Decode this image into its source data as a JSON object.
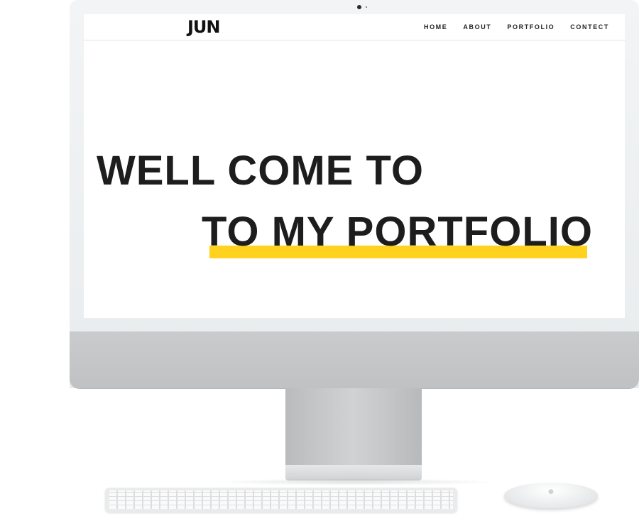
{
  "site": {
    "logo": "JUN",
    "nav": [
      {
        "label": "HOME"
      },
      {
        "label": "ABOUT"
      },
      {
        "label": "PORTFOLIO"
      },
      {
        "label": "CONTECT"
      }
    ]
  },
  "hero": {
    "line1": "WELL COME TO",
    "line2": "TO MY PORTFOLIO",
    "highlight_color": "#ffd21f"
  },
  "device": {
    "type": "imac",
    "mouse_logo_icon": "apple-icon"
  }
}
